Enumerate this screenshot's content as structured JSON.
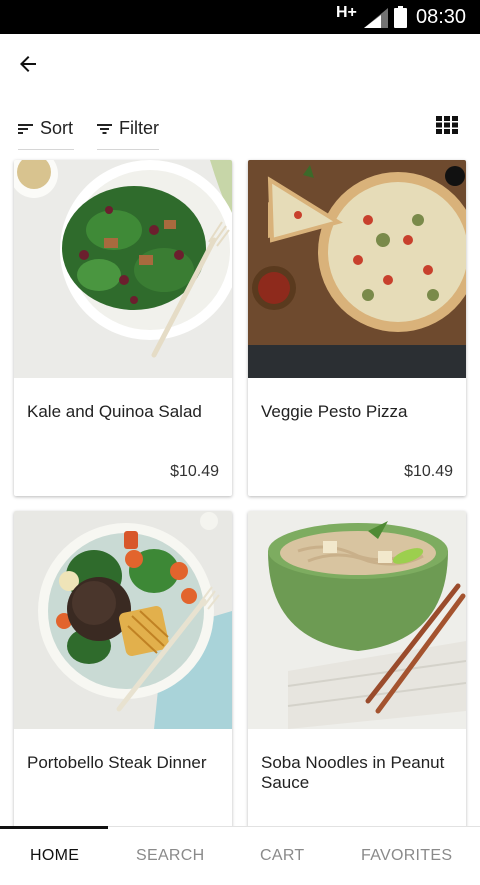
{
  "status_bar": {
    "network": "H+",
    "time": "08:30"
  },
  "toolbar": {
    "sort_label": "Sort",
    "filter_label": "Filter"
  },
  "products": [
    {
      "name": "Kale and Quinoa Salad",
      "price": "$10.49"
    },
    {
      "name": "Veggie Pesto Pizza",
      "price": "$10.49"
    },
    {
      "name": "Portobello Steak Dinner",
      "price": ""
    },
    {
      "name": "Soba Noodles in Peanut Sauce",
      "price": ""
    }
  ],
  "bottom_nav": {
    "tabs": [
      {
        "label": "HOME",
        "active": true
      },
      {
        "label": "SEARCH",
        "active": false
      },
      {
        "label": "CART",
        "active": false
      },
      {
        "label": "FAVORITES",
        "active": false
      }
    ]
  },
  "icons": {
    "back": "arrow-left-icon",
    "sort": "sort-icon",
    "filter": "filter-icon",
    "view_toggle": "grid-view-icon"
  },
  "colors": {
    "active_tab": "#111111",
    "inactive_tab": "#8a8a8a"
  }
}
